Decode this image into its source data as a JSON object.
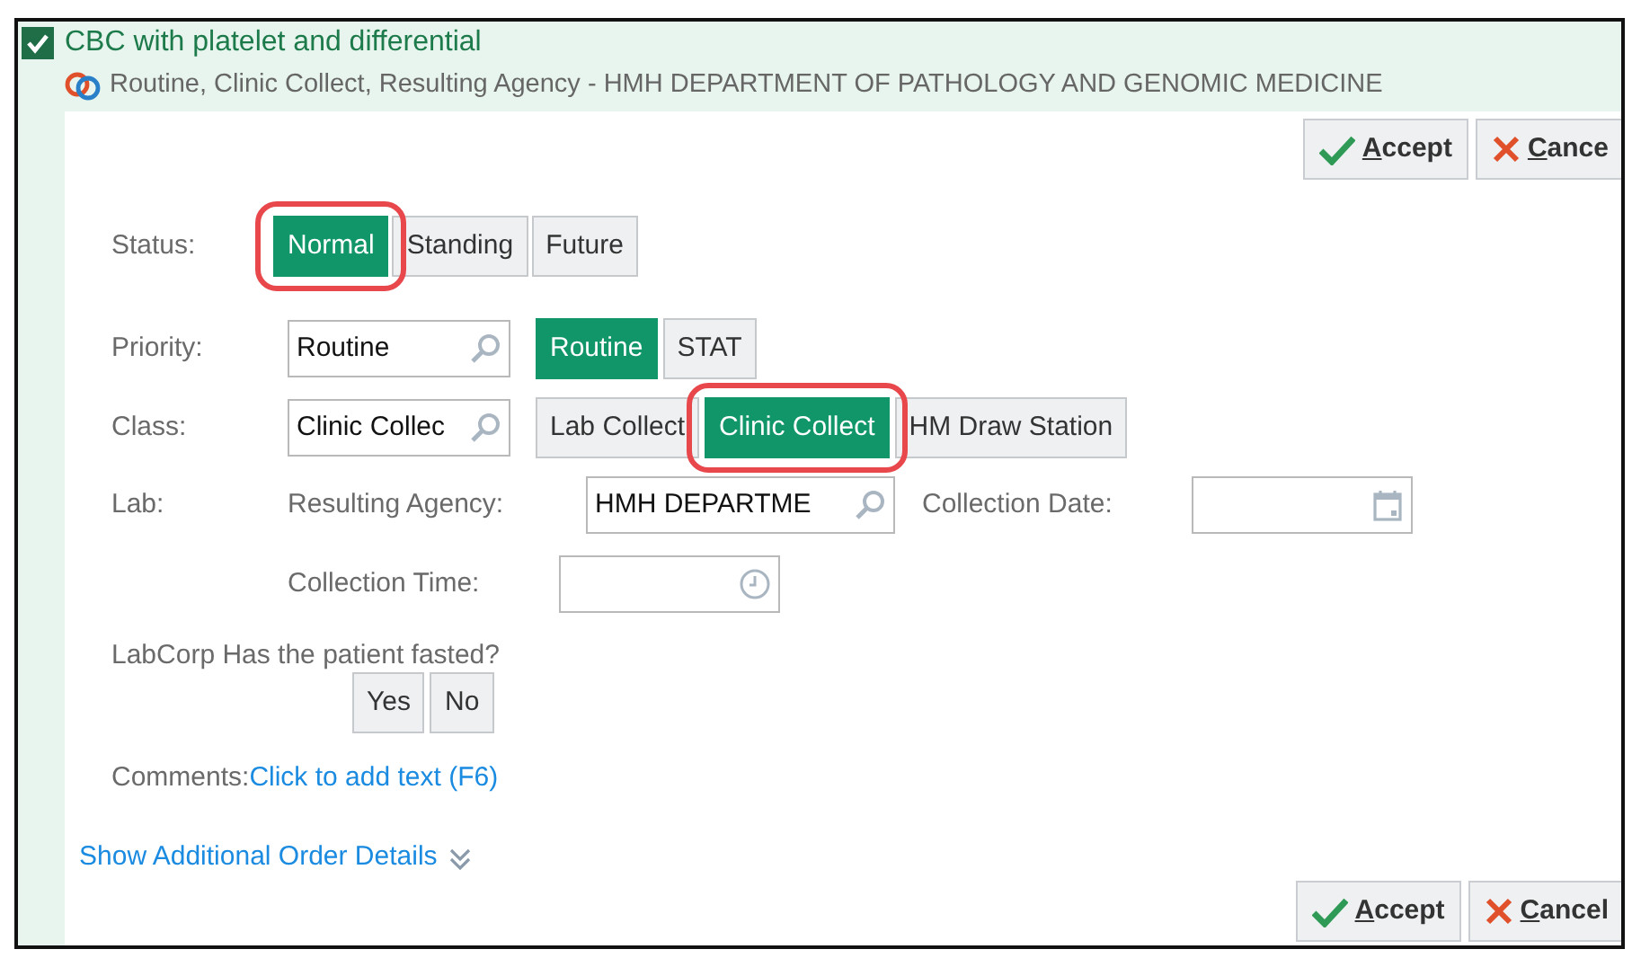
{
  "order": {
    "checked": true,
    "title": "CBC with platelet and differential",
    "summary": "Routine, Clinic Collect, Resulting Agency - HMH DEPARTMENT OF PATHOLOGY AND GENOMIC MEDICINE"
  },
  "top_actions": [
    {
      "kind": "accept",
      "label": "Accept"
    },
    {
      "kind": "cancel",
      "label": "Cance"
    }
  ],
  "status": {
    "label": "Status:",
    "options": [
      {
        "label": "Normal",
        "selected": true,
        "annotated": true
      },
      {
        "label": "Standing",
        "selected": false,
        "annotated": false
      },
      {
        "label": "Future",
        "selected": false,
        "annotated": false
      }
    ]
  },
  "priority": {
    "label": "Priority:",
    "value": "Routine",
    "options": [
      {
        "label": "Routine",
        "selected": true,
        "annotated": false
      },
      {
        "label": "STAT",
        "selected": false,
        "annotated": false
      }
    ]
  },
  "class": {
    "label": "Class:",
    "value": "Clinic Collec",
    "options": [
      {
        "label": "Lab Collect",
        "selected": false,
        "annotated": false
      },
      {
        "label": "Clinic Collect",
        "selected": true,
        "annotated": true
      },
      {
        "label": "HM Draw Station",
        "selected": false,
        "annotated": false
      }
    ]
  },
  "lab": {
    "label": "Lab:",
    "resulting_agency_label": "Resulting Agency:",
    "resulting_agency_value": "HMH DEPARTME",
    "collection_date_label": "Collection Date:",
    "collection_time_label": "Collection Time:"
  },
  "question": {
    "text": "LabCorp Has the patient fasted?",
    "options": [
      {
        "label": "Yes",
        "selected": false
      },
      {
        "label": "No",
        "selected": false
      }
    ]
  },
  "comments": {
    "label": "Comments:",
    "link": "Click to add text (F6)"
  },
  "details_link": "Show Additional Order Details",
  "bottom_actions": [
    {
      "kind": "accept",
      "label": "Accept"
    },
    {
      "kind": "cancel",
      "label": "Cancel"
    }
  ]
}
